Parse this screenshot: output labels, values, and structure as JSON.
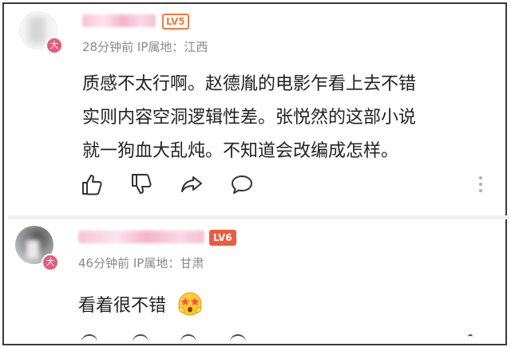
{
  "comments": [
    {
      "level": "LV5",
      "verified_badge": "大",
      "time": "28分钟前",
      "ip_location": "IP属地：江西",
      "text_lines": [
        "质感不太行啊。赵德胤的电影乍看上去不错",
        "实则内容空洞逻辑性差。张悦然的这部小说",
        "就一狗血大乱炖。不知道会改编成怎样。"
      ],
      "actions": {
        "like": "thumbs-up-icon",
        "dislike": "thumbs-down-icon",
        "share": "share-icon",
        "reply": "comment-icon",
        "more": "more-vertical-icon"
      }
    },
    {
      "level": "LV6",
      "verified_badge": "大",
      "time": "46分钟前",
      "ip_location": "IP属地：甘肃",
      "text": "看着很不错",
      "emoji": "star-struck-emoji"
    }
  ],
  "colors": {
    "level_badge": "#f07c3c",
    "level_badge_filled": "#f05a3c",
    "verified_badge": "#e75a7c",
    "meta_text": "#8a8a8a",
    "body_text": "#222222"
  }
}
